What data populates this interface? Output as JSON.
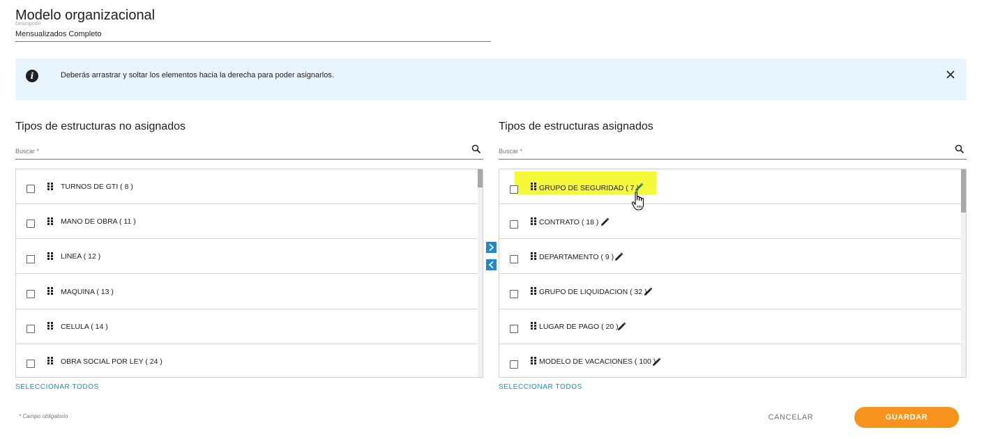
{
  "header": {
    "title": "Modelo organizacional",
    "description_label": "Descripción",
    "description_value": "Mensualizados Completo"
  },
  "alert": {
    "icon": "info-icon",
    "text": "Deberás arrastrar y soltar los elementos hacia la derecha para poder asignarlos.",
    "close_icon": "close-icon"
  },
  "unassigned": {
    "title": "Tipos de estructuras no asignados",
    "search_placeholder": "Buscar *",
    "select_all": "SELECCIONAR TODOS",
    "items": [
      {
        "label": "TURNOS DE GTI ( 8 )"
      },
      {
        "label": "MANO DE OBRA ( 11 )"
      },
      {
        "label": "LINEA ( 12 )"
      },
      {
        "label": "MAQUINA ( 13 )"
      },
      {
        "label": "CELULA ( 14 )"
      },
      {
        "label": "OBRA SOCIAL POR LEY ( 24 )"
      }
    ]
  },
  "assigned": {
    "title": "Tipos de estructuras asignados",
    "search_placeholder": "Buscar *",
    "select_all": "SELECCIONAR TODOS",
    "items": [
      {
        "label": "GRUPO DE SEGURIDAD ( 7 )",
        "highlighted": true
      },
      {
        "label": "CONTRATO ( 18 )"
      },
      {
        "label": "DEPARTAMENTO ( 9 )"
      },
      {
        "label": "GRUPO DE LIQUIDACION ( 32 )"
      },
      {
        "label": "LUGAR DE PAGO ( 20 )"
      },
      {
        "label": "MODELO DE VACACIONES ( 100 )"
      }
    ]
  },
  "transfer": {
    "move_right_icon": "chevron-right-icon",
    "move_left_icon": "chevron-left-icon"
  },
  "footer": {
    "required_note": "* Campo obligatorio",
    "cancel_label": "CANCELAR",
    "save_label": "GUARDAR"
  },
  "colors": {
    "accent_blue": "#1e88d0",
    "save_orange": "#f7941d",
    "alert_bg": "#e8f4fd",
    "highlight_yellow": "#f6f83a",
    "edit_active_green": "#1e8a5a"
  }
}
